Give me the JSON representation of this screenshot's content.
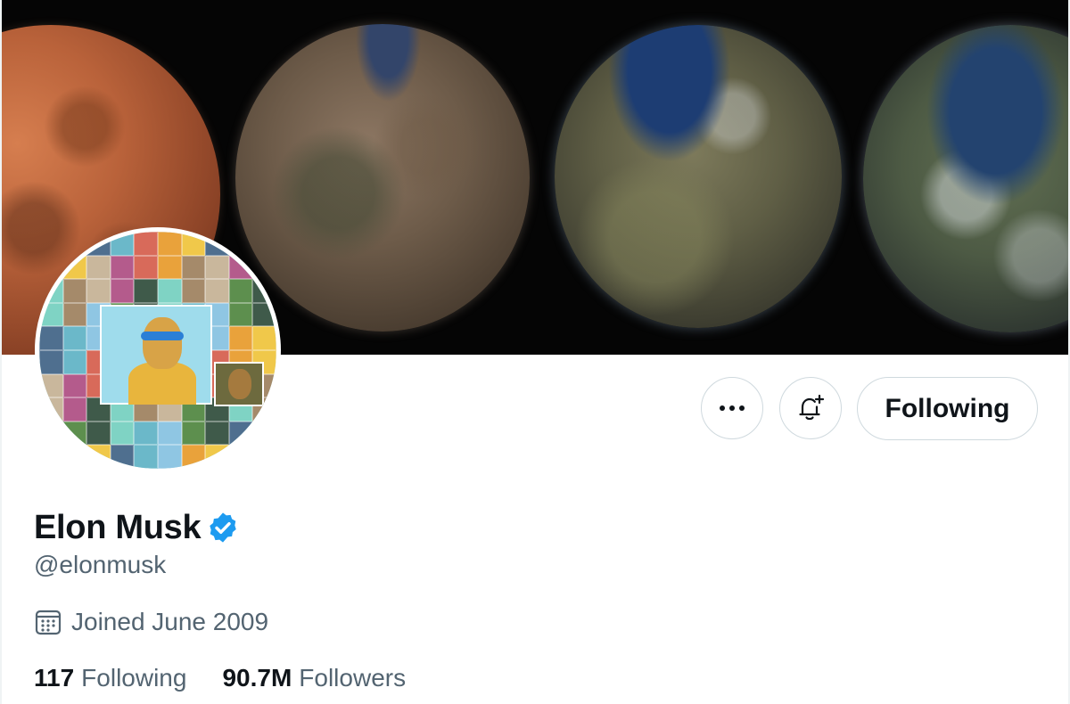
{
  "profile": {
    "name": "Elon Musk",
    "handle": "@elonmusk",
    "joined": "Joined June 2009",
    "verified": true
  },
  "actions": {
    "more_icon": "more-horizontal-icon",
    "notify_icon": "bell-plus-icon",
    "following_label": "Following"
  },
  "stats": {
    "following_count": "117",
    "following_label": "Following",
    "followers_count": "90.7M",
    "followers_label": "Followers"
  },
  "colors": {
    "verified_blue": "#1d9bf0",
    "text_primary": "#0f1419",
    "text_secondary": "#536471",
    "border": "#cfd9de"
  }
}
